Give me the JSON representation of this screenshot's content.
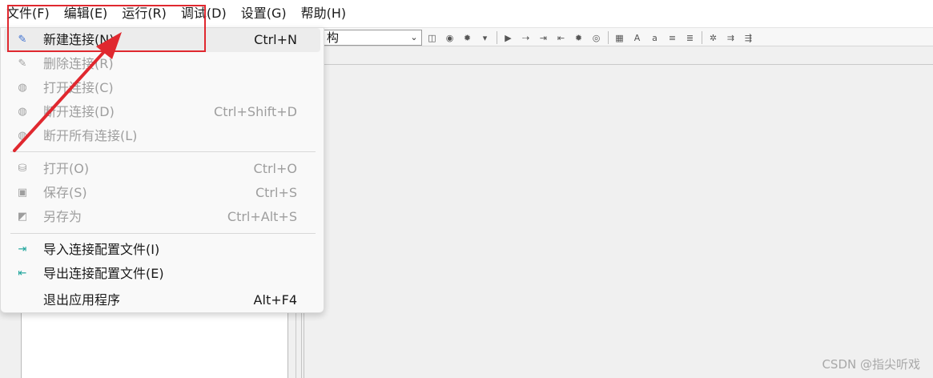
{
  "menubar": {
    "items": [
      "文件(F)",
      "编辑(E)",
      "运行(R)",
      "调试(D)",
      "设置(G)",
      "帮助(H)"
    ]
  },
  "toolbar": {
    "combo_value": "构",
    "icons": [
      "new-query-icon",
      "run-icon",
      "debug-icon",
      "down-arrow-icon",
      "run-script-icon",
      "step-icon",
      "step-over-icon",
      "step-out-icon",
      "breakpoint-icon",
      "watch-icon",
      "format-icon",
      "uppercase-icon",
      "lowercase-icon",
      "indent-icon",
      "outdent-icon",
      "comment-icon",
      "uncomment-icon",
      "align-icon"
    ]
  },
  "file_menu": {
    "items": [
      {
        "label": "新建连接(N)",
        "shortcut": "Ctrl+N",
        "icon": "new-connection-icon",
        "enabled": true,
        "highlighted": true
      },
      {
        "label": "删除连接(R)",
        "shortcut": "",
        "icon": "delete-connection-icon",
        "enabled": false
      },
      {
        "label": "打开连接(C)",
        "shortcut": "",
        "icon": "open-connection-icon",
        "enabled": false
      },
      {
        "label": "断开连接(D)",
        "shortcut": "Ctrl+Shift+D",
        "icon": "disconnect-icon",
        "enabled": false
      },
      {
        "label": "断开所有连接(L)",
        "shortcut": "",
        "icon": "disconnect-all-icon",
        "enabled": false
      },
      {
        "label": "打开(O)",
        "shortcut": "Ctrl+O",
        "icon": "open-file-icon",
        "enabled": false
      },
      {
        "label": "保存(S)",
        "shortcut": "Ctrl+S",
        "icon": "save-icon",
        "enabled": false
      },
      {
        "label": "另存为",
        "shortcut": "Ctrl+Alt+S",
        "icon": "save-as-icon",
        "enabled": false
      },
      {
        "label": "导入连接配置文件(I)",
        "shortcut": "",
        "icon": "import-icon",
        "enabled": true
      },
      {
        "label": "导出连接配置文件(E)",
        "shortcut": "",
        "icon": "export-icon",
        "enabled": true
      },
      {
        "label": "退出应用程序",
        "shortcut": "Alt+F4",
        "icon": "",
        "enabled": true
      }
    ]
  },
  "annotation": {
    "color": "#e0282f"
  },
  "watermark": "CSDN @指尖听戏",
  "colors": {
    "highlight": "#ececec",
    "disabled_text": "#9e9e9e",
    "import_export_accent": "#1aa39a"
  }
}
